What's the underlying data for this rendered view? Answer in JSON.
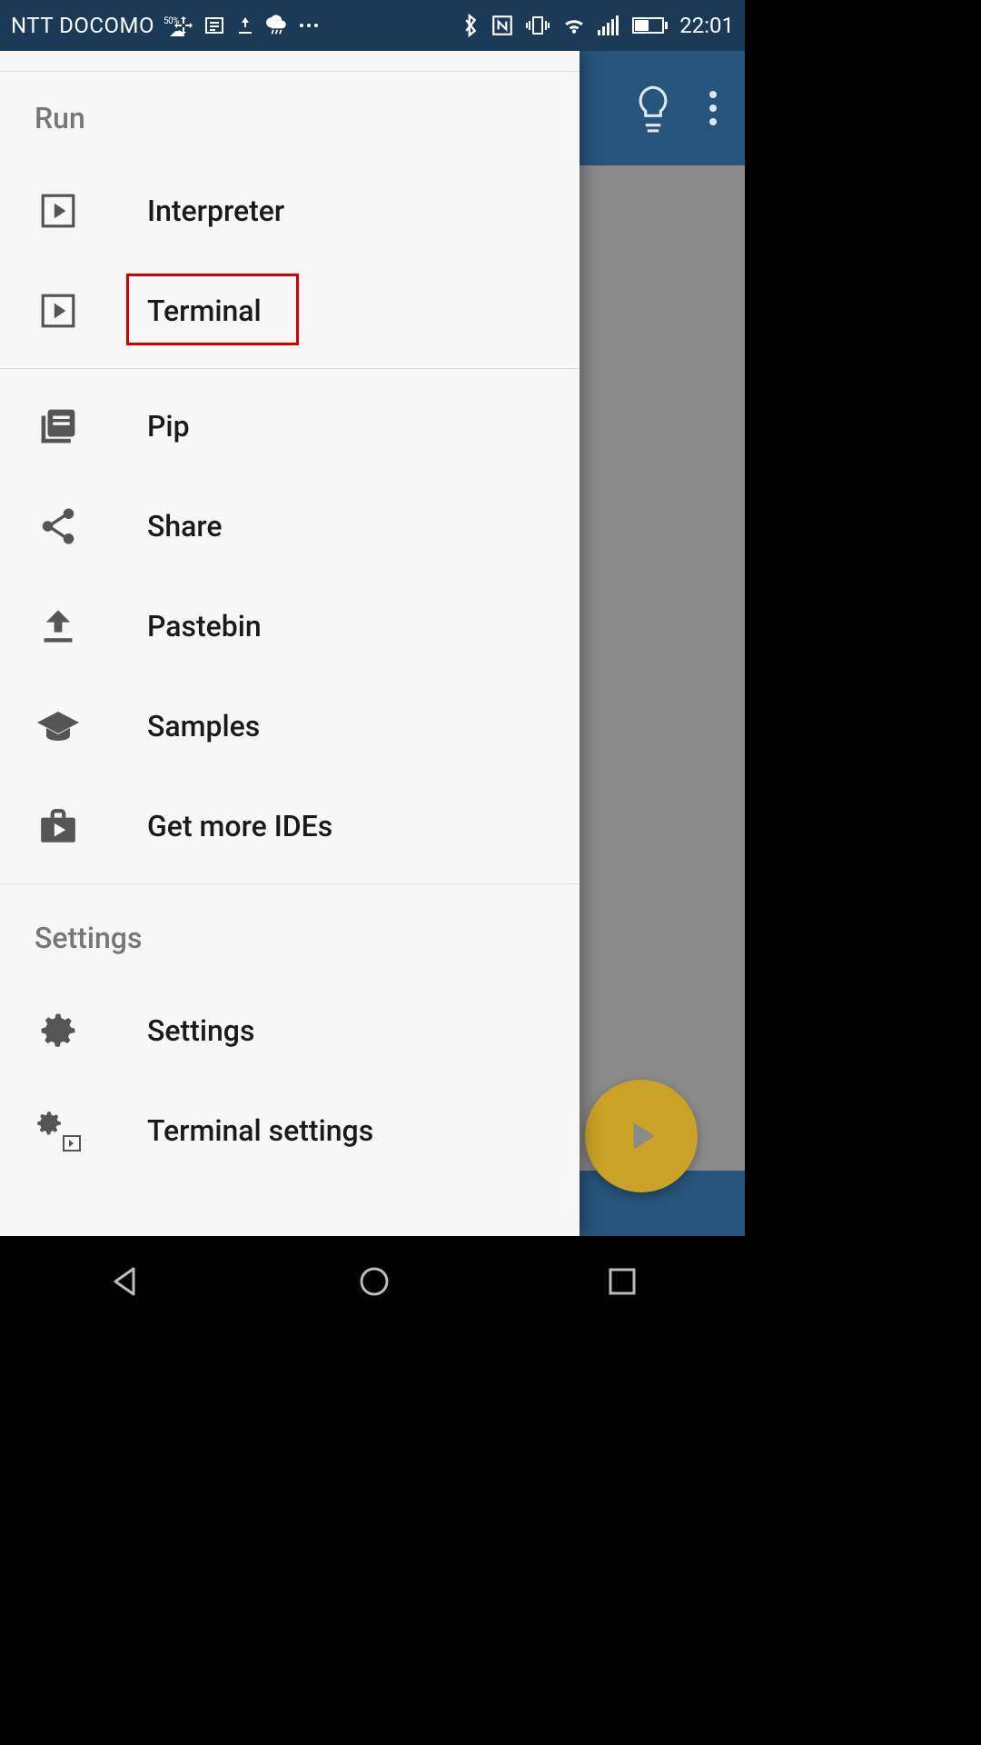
{
  "status": {
    "carrier": "NTT DOCOMO",
    "weather_pct": "50%",
    "time": "22:01"
  },
  "drawer": {
    "sections": {
      "run": {
        "header": "Run",
        "items": [
          {
            "label": "Interpreter"
          },
          {
            "label": "Terminal"
          }
        ]
      },
      "mid": {
        "items": [
          {
            "label": "Pip"
          },
          {
            "label": "Share"
          },
          {
            "label": "Pastebin"
          },
          {
            "label": "Samples"
          },
          {
            "label": "Get more IDEs"
          }
        ]
      },
      "settings": {
        "header": "Settings",
        "items": [
          {
            "label": "Settings"
          },
          {
            "label": "Terminal settings"
          }
        ]
      }
    }
  },
  "keyboard": {
    "hash": "#",
    "paren": "("
  }
}
